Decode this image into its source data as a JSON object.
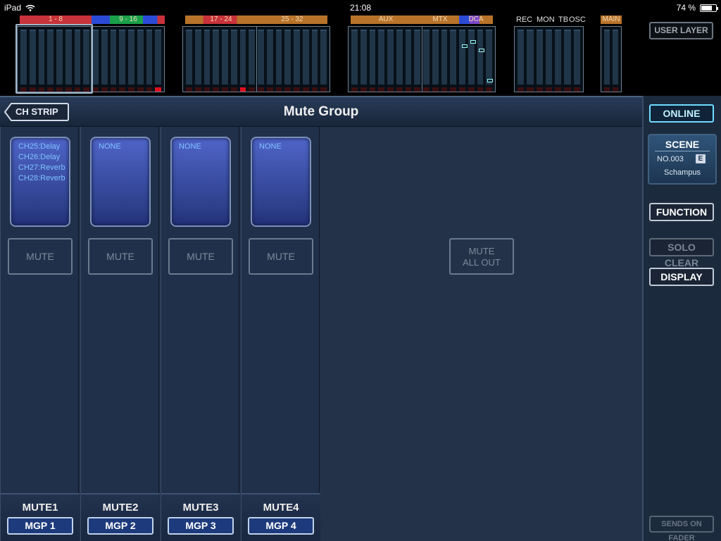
{
  "status_bar": {
    "device": "iPad",
    "time": "21:08",
    "battery": "74 %",
    "battery_level": 0.74
  },
  "meters": {
    "groups": [
      {
        "labels": [
          "1 - 8",
          "9 - 16"
        ],
        "label_colors": [
          "#c8323a",
          "#2b4bd6"
        ]
      },
      {
        "labels": [
          "17 - 24",
          "25 - 32"
        ],
        "label_colors": [
          "#b8732a",
          "#b8732a"
        ]
      },
      {
        "labels": [
          "AUX",
          "MTX",
          "DCA"
        ],
        "label_colors": [
          "#b8732a",
          "#b8732a",
          "#7a48c8"
        ]
      },
      {
        "labels": [
          "REC",
          "MON",
          "TB",
          "OSC"
        ]
      },
      {
        "labels": [
          "MAIN"
        ],
        "label_colors": [
          "#b8732a"
        ]
      }
    ],
    "user_layer": "USER LAYER"
  },
  "header": {
    "title": "Mute Group",
    "back_label": "CH STRIP"
  },
  "mute_groups": [
    {
      "assignments": [
        "CH25:Delay",
        "CH26:Delay",
        "CH27:Reverb",
        "CH28:Reverb"
      ],
      "mute_label": "MUTE",
      "name": "MUTE1",
      "button": "MGP 1"
    },
    {
      "assignments": [
        "NONE"
      ],
      "mute_label": "MUTE",
      "name": "MUTE2",
      "button": "MGP 2"
    },
    {
      "assignments": [
        "NONE"
      ],
      "mute_label": "MUTE",
      "name": "MUTE3",
      "button": "MGP 3"
    },
    {
      "assignments": [
        "NONE"
      ],
      "mute_label": "MUTE",
      "name": "MUTE4",
      "button": "MGP 4"
    }
  ],
  "mute_all_out": {
    "line1": "MUTE",
    "line2": "ALL OUT"
  },
  "right_panel": {
    "online": "ONLINE",
    "scene": {
      "title": "SCENE",
      "number": "NO.003",
      "edit_flag": "E",
      "name": "Schampus"
    },
    "function": "FUNCTION",
    "solo_clear": "SOLO CLEAR",
    "display": "DISPLAY",
    "sends_on_fader": "SENDS ON FADER"
  }
}
